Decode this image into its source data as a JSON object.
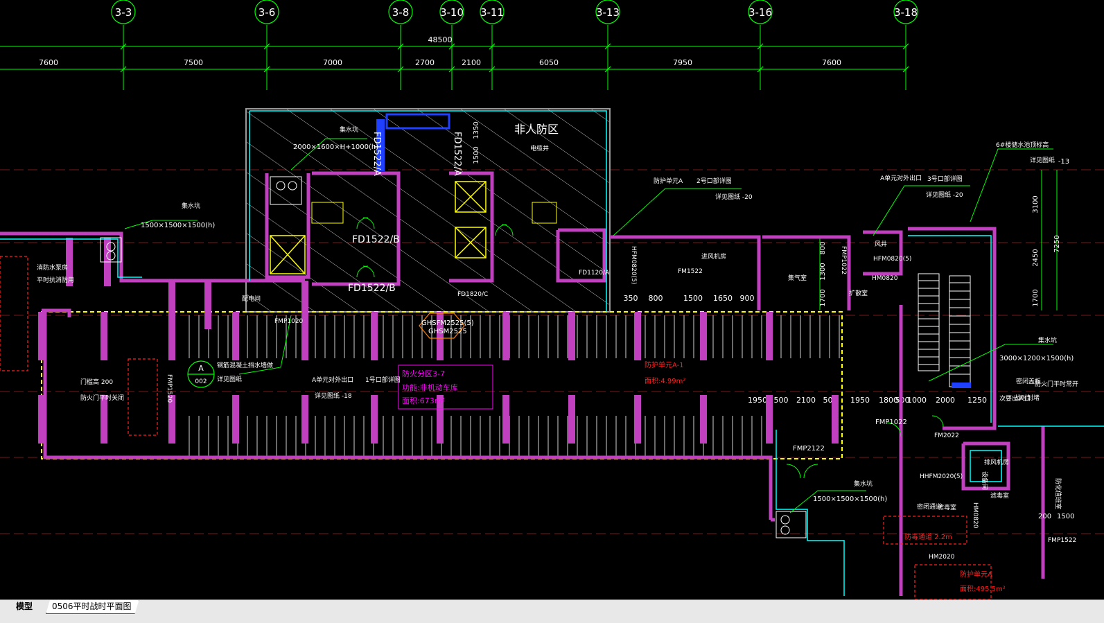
{
  "app": {
    "layout_tabs": [
      {
        "label": "模型",
        "active": false
      },
      {
        "label": "0506平时战时平面图",
        "active": true
      }
    ]
  },
  "colors": {
    "background": "#000000",
    "grid_axis": "#00ff00",
    "wall": "#c040c0",
    "wall_fill": "#808080",
    "cyan_line": "#00ffff",
    "yellow_line": "#ffff00",
    "red_annotation": "#ff2020",
    "white_text": "#ffffff",
    "blue_equipment": "#2040ff",
    "magenta_text": "#ff00ff"
  },
  "drawing": {
    "grid_axes": [
      "3-3",
      "3-6",
      "3-8",
      "3-10",
      "3-11",
      "3-13",
      "3-16",
      "3-18"
    ],
    "overall_dimension": "48500",
    "bay_dimensions": [
      "7600",
      "7500",
      "7000",
      "2700",
      "2100",
      "6050",
      "7950",
      "7600"
    ],
    "vertical_dimensions": [
      "1350",
      "1500",
      "3100",
      "2450",
      "7250",
      "1700",
      "800",
      "1300",
      "1700",
      "-13"
    ],
    "row_dimensions_a": [
      "350",
      "800",
      "1500",
      "1650",
      "900"
    ],
    "row_dimensions_b": [
      "1950",
      "500",
      "2100",
      "500",
      "1950",
      "1800",
      "500",
      "1000",
      "2000",
      "1250"
    ],
    "labels_white": [
      "非人防区",
      "集水坑",
      "2000×1600×H+1000(h)",
      "FD1522/A",
      "FD1522/A",
      "电缆井",
      "集水坑",
      "1500×1500×1500(h)",
      "FD1522/B",
      "FD1522/B",
      "FD1120/A",
      "FD1820/C",
      "防护单元A",
      "2号口部详图",
      "详见图纸 -20",
      "A单元对外出口",
      "3号口部详图",
      "详见图纸 -20",
      "6#楼储水池顶标高",
      "详见图纸",
      "FM1522",
      "HFM0820(5)",
      "HM0820",
      "FMP1022",
      "配电间",
      "GHSFM2525(5)",
      "GHSM2525",
      "消防水泵房",
      "平时抗消防用",
      "门槛高 200",
      "防火门平时关闭",
      "FMP1520",
      "钢筋混凝土挡水墙做",
      "详见图纸",
      "A单元对外出口",
      "1号口部详图",
      "详见图纸 -18",
      "FMP1020",
      "集水坑",
      "3000×1200×1500(h)",
      "密闭盖板",
      "次要出入口",
      "FMP1022",
      "FM2022",
      "FMP2122",
      "集水坑",
      "1500×1500×1500(h)",
      "HHFM2020(5)",
      "HM2020",
      "HM0820",
      "密闭通道",
      "滤毒室",
      "FMP1522",
      "200",
      "1500",
      "防化值班室",
      "排风机房",
      "风井",
      "设备间",
      "进风机房",
      "集气室",
      "扩散室",
      "防火门平时常开",
      "战时封堵",
      "滤毒室",
      "HFM0820(5)"
    ],
    "labels_magenta": [
      "防火分区3-7",
      "功能:非机动车库",
      "面积:673m²"
    ],
    "labels_red": [
      "防护单元A-1",
      "面积:4.99m²",
      "防护单元A",
      "面积:495.5m²",
      "防毒通道 2.2m"
    ],
    "axis_bubble": {
      "letter": "A",
      "number": "002"
    },
    "symbols": {
      "sump": "sump-pit-symbol",
      "stair": "stair-symbol",
      "door": "door-swing-symbol"
    }
  }
}
